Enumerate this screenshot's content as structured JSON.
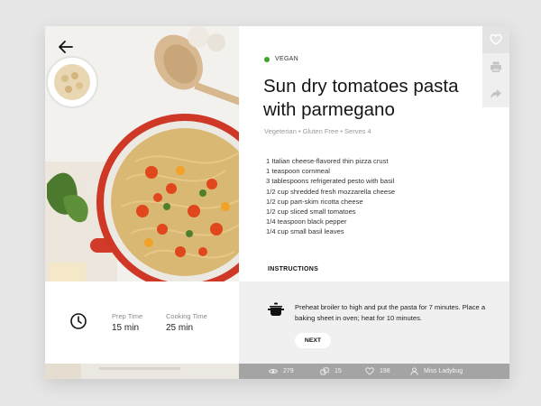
{
  "recipe": {
    "tag": "VEGAN",
    "title": "Sun dry tomatoes pasta with parmegano",
    "subtitle": "Vegeterian • Gluten Free • Serves 4",
    "ingredients": [
      "1 Italian cheese-flavored thin pizza crust",
      "1 teaspoon cornmeal",
      "3 tablespoons refrigerated pesto with basil",
      "1/2 cup shredded fresh mozzarella cheese",
      "1/2 cup part-skim ricotta cheese",
      "1/2 cup sliced small tomatoes",
      "1/4 teaspoon black pepper",
      "1/4 cup small basil leaves"
    ],
    "instructions_label": "INSTRUCTIONS"
  },
  "times": {
    "prep_label": "Prep Time",
    "prep_value": "15 min",
    "cook_label": "Cooking Time",
    "cook_value": "25 min"
  },
  "instruction": {
    "text": "Preheat broiler to high and put the pasta for 7 minutes. Place a baking sheet in oven; heat for 10 minutes.",
    "next_label": "NEXT"
  },
  "stats": {
    "views": "279",
    "shares": "15",
    "likes": "198",
    "author": "Miss Ladybug"
  },
  "icons": {
    "back": "arrow-left-icon",
    "heart": "heart-icon",
    "print": "printer-icon",
    "share": "share-icon",
    "clock": "clock-icon",
    "pot": "cooking-pot-icon"
  },
  "colors": {
    "vegan_dot": "#3fa52b",
    "footer_bg": "#a4a4a4",
    "panel_bg": "#f0f0f0",
    "side_bar_bg": "#efefef"
  }
}
